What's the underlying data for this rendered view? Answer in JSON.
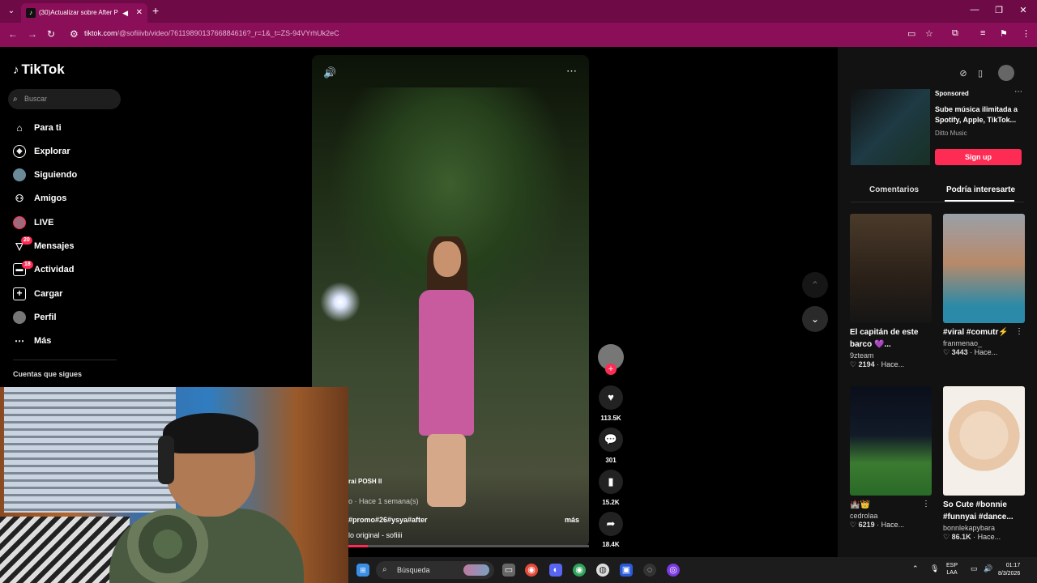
{
  "browser": {
    "tab_title": "(30)Actualizar sobre After P",
    "url_main": "tiktok.com",
    "url_rest": "/@sofiiivb/video/7611989013766884616?_r=1&_t=ZS-94VYrhUk2eC"
  },
  "sidebar": {
    "logo": "TikTok",
    "search_placeholder": "Buscar",
    "items": [
      {
        "label": "Para ti",
        "icon": "home-icon"
      },
      {
        "label": "Explorar",
        "icon": "compass-icon"
      },
      {
        "label": "Siguiendo",
        "icon": "following-icon"
      },
      {
        "label": "Amigos",
        "icon": "friends-icon"
      },
      {
        "label": "LIVE",
        "icon": "live-icon"
      },
      {
        "label": "Mensajes",
        "icon": "messages-icon",
        "badge": "20"
      },
      {
        "label": "Actividad",
        "icon": "activity-icon",
        "badge": "18"
      },
      {
        "label": "Cargar",
        "icon": "upload-icon"
      },
      {
        "label": "Perfil",
        "icon": "profile-icon"
      },
      {
        "label": "Más",
        "icon": "more-icon"
      }
    ],
    "following_title": "Cuentas que sigues"
  },
  "video": {
    "tag_label": "rai POSH II",
    "meta": "o · Hace 1 semana(s)",
    "hashtags": "#promo#26#ysya#after",
    "more": "más",
    "sound": "lo original - sofiiii",
    "progress": 0.08
  },
  "actions": {
    "likes": "113.5K",
    "comments": "301",
    "saves": "15.2K",
    "shares": "18.4K"
  },
  "ad": {
    "sponsored": "Sponsored",
    "text": "Sube música ilimitada a Spotify, Apple, TikTok...",
    "brand": "Ditto Music",
    "cta": "Sign up"
  },
  "rtabs": {
    "comments": "Comentarios",
    "suggested": "Podría interesarte"
  },
  "cards": [
    {
      "title": "El capitán de este",
      "title2": "barco 💜...",
      "user": "9zteam",
      "likes": "2194",
      "time": "Hace..."
    },
    {
      "title": "#viral #comutr⚡",
      "title2": "",
      "user": "franmenao_",
      "likes": "3443",
      "time": "Hace..."
    },
    {
      "title": "🏰👑",
      "title2": "",
      "user": "cedrolaa",
      "likes": "6219",
      "time": "Hace..."
    },
    {
      "title": "So Cute #bonnie",
      "title2": "#funnyai #dance...",
      "user": "bonnlekapybara",
      "likes": "86.1K",
      "time": "Hace..."
    }
  ],
  "taskbar": {
    "search": "Búsqueda",
    "lang1": "ESP",
    "lang2": "LAA",
    "time": "01:17",
    "date": "8/3/2026"
  }
}
